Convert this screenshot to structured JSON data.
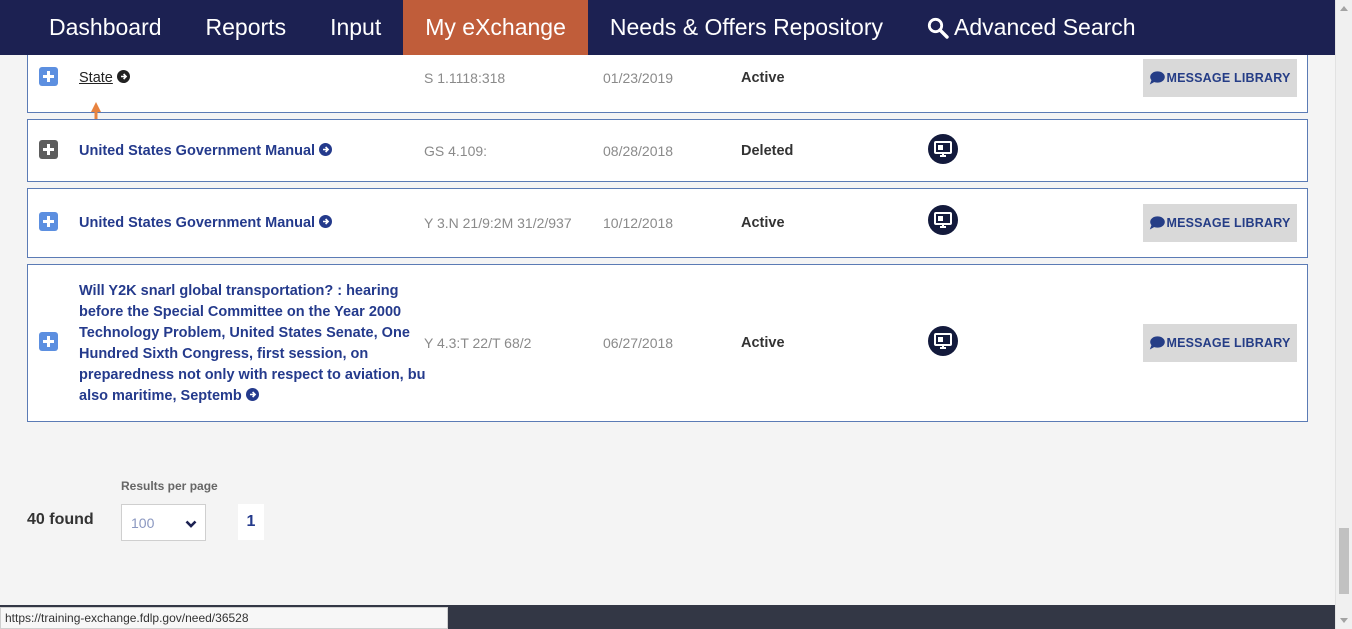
{
  "nav": {
    "items": [
      {
        "label": "Dashboard"
      },
      {
        "label": "Reports"
      },
      {
        "label": "Input"
      },
      {
        "label": "My eXchange"
      },
      {
        "label": "Needs & Offers Repository"
      },
      {
        "label": "Advanced Search"
      }
    ],
    "active_index": 3,
    "colors": {
      "bar": "#1c2152",
      "active": "#c05d3a"
    }
  },
  "rows": [
    {
      "title": "State",
      "sudoc": "S 1.1118:318",
      "date": "01/23/2019",
      "status": "Active",
      "has_monitor": false,
      "has_message_button": true,
      "button": "MESSAGE LIBRARY",
      "visited": true
    },
    {
      "title": "United States Government Manual",
      "sudoc": "GS 4.109:",
      "date": "08/28/2018",
      "status": "Deleted",
      "has_monitor": true,
      "has_message_button": false,
      "button": "",
      "visited": false
    },
    {
      "title": "United States Government Manual",
      "sudoc": "Y 3.N 21/9:2M 31/2/937",
      "date": "10/12/2018",
      "status": "Active",
      "has_monitor": true,
      "has_message_button": true,
      "button": "MESSAGE LIBRARY",
      "visited": false
    },
    {
      "title": "Will Y2K snarl global transportation? : hearing before the Special Committee on the Year 2000 Technology Problem, United States Senate, One Hundred Sixth Congress, first session, on preparedness not only with respect to aviation, bu also maritime, Septemb",
      "sudoc": "Y 4.3:T 22/T 68/2",
      "date": "06/27/2018",
      "status": "Active",
      "has_monitor": true,
      "has_message_button": true,
      "button": "MESSAGE LIBRARY",
      "visited": false
    }
  ],
  "pagination": {
    "found": "40 found",
    "results_per_page_label": "Results per page",
    "results_per_page_value": "100",
    "page": "1"
  },
  "statusbar": {
    "url": "https://training-exchange.fdlp.gov/need/36528"
  }
}
